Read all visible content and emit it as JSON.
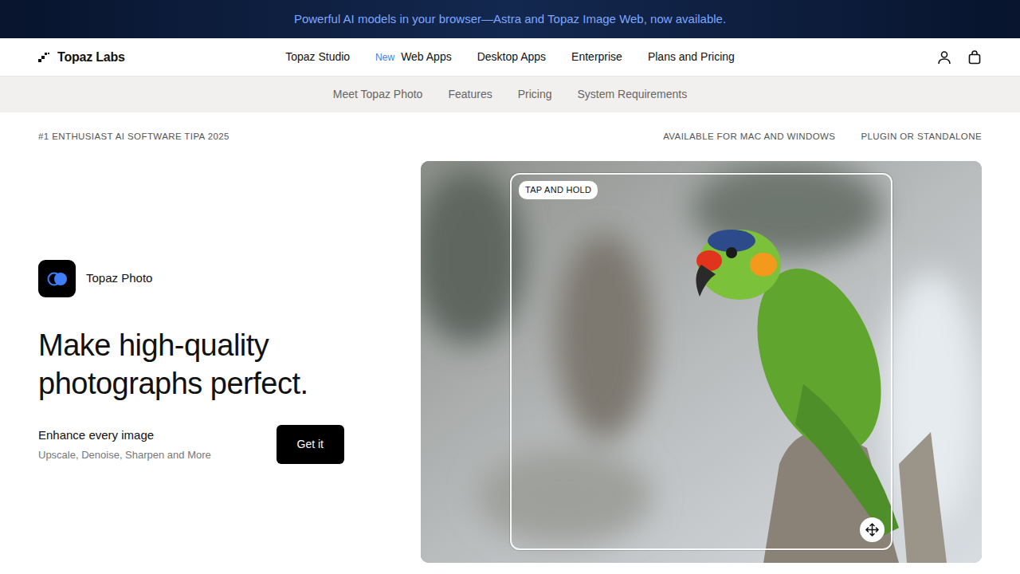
{
  "banner": {
    "text": "Powerful AI models in your browser—Astra and Topaz Image Web, now available."
  },
  "brand": {
    "name": "Topaz Labs"
  },
  "nav": {
    "items": [
      {
        "label": "Topaz Studio"
      },
      {
        "label": "Web Apps",
        "badge": "New"
      },
      {
        "label": "Desktop Apps"
      },
      {
        "label": "Enterprise"
      },
      {
        "label": "Plans and Pricing"
      }
    ]
  },
  "subnav": {
    "items": [
      {
        "label": "Meet Topaz Photo",
        "selected": false
      },
      {
        "label": "Features",
        "selected": false
      },
      {
        "label": "Pricing",
        "selected": false
      },
      {
        "label": "System Requirements",
        "selected": false
      }
    ]
  },
  "tags": {
    "award": "#1 ENTHUSIAST AI SOFTWARE TIPA 2025",
    "right": [
      "AVAILABLE FOR MAC AND WINDOWS",
      "PLUGIN OR STANDALONE"
    ]
  },
  "hero": {
    "app_name": "Topaz Photo",
    "heading": "Make high-quality photographs perfect.",
    "subtitle": "Enhance every image",
    "features": "Upscale, Denoise, Sharpen and More",
    "button": "Get it"
  },
  "photo": {
    "hint": "TAP AND HOLD"
  }
}
